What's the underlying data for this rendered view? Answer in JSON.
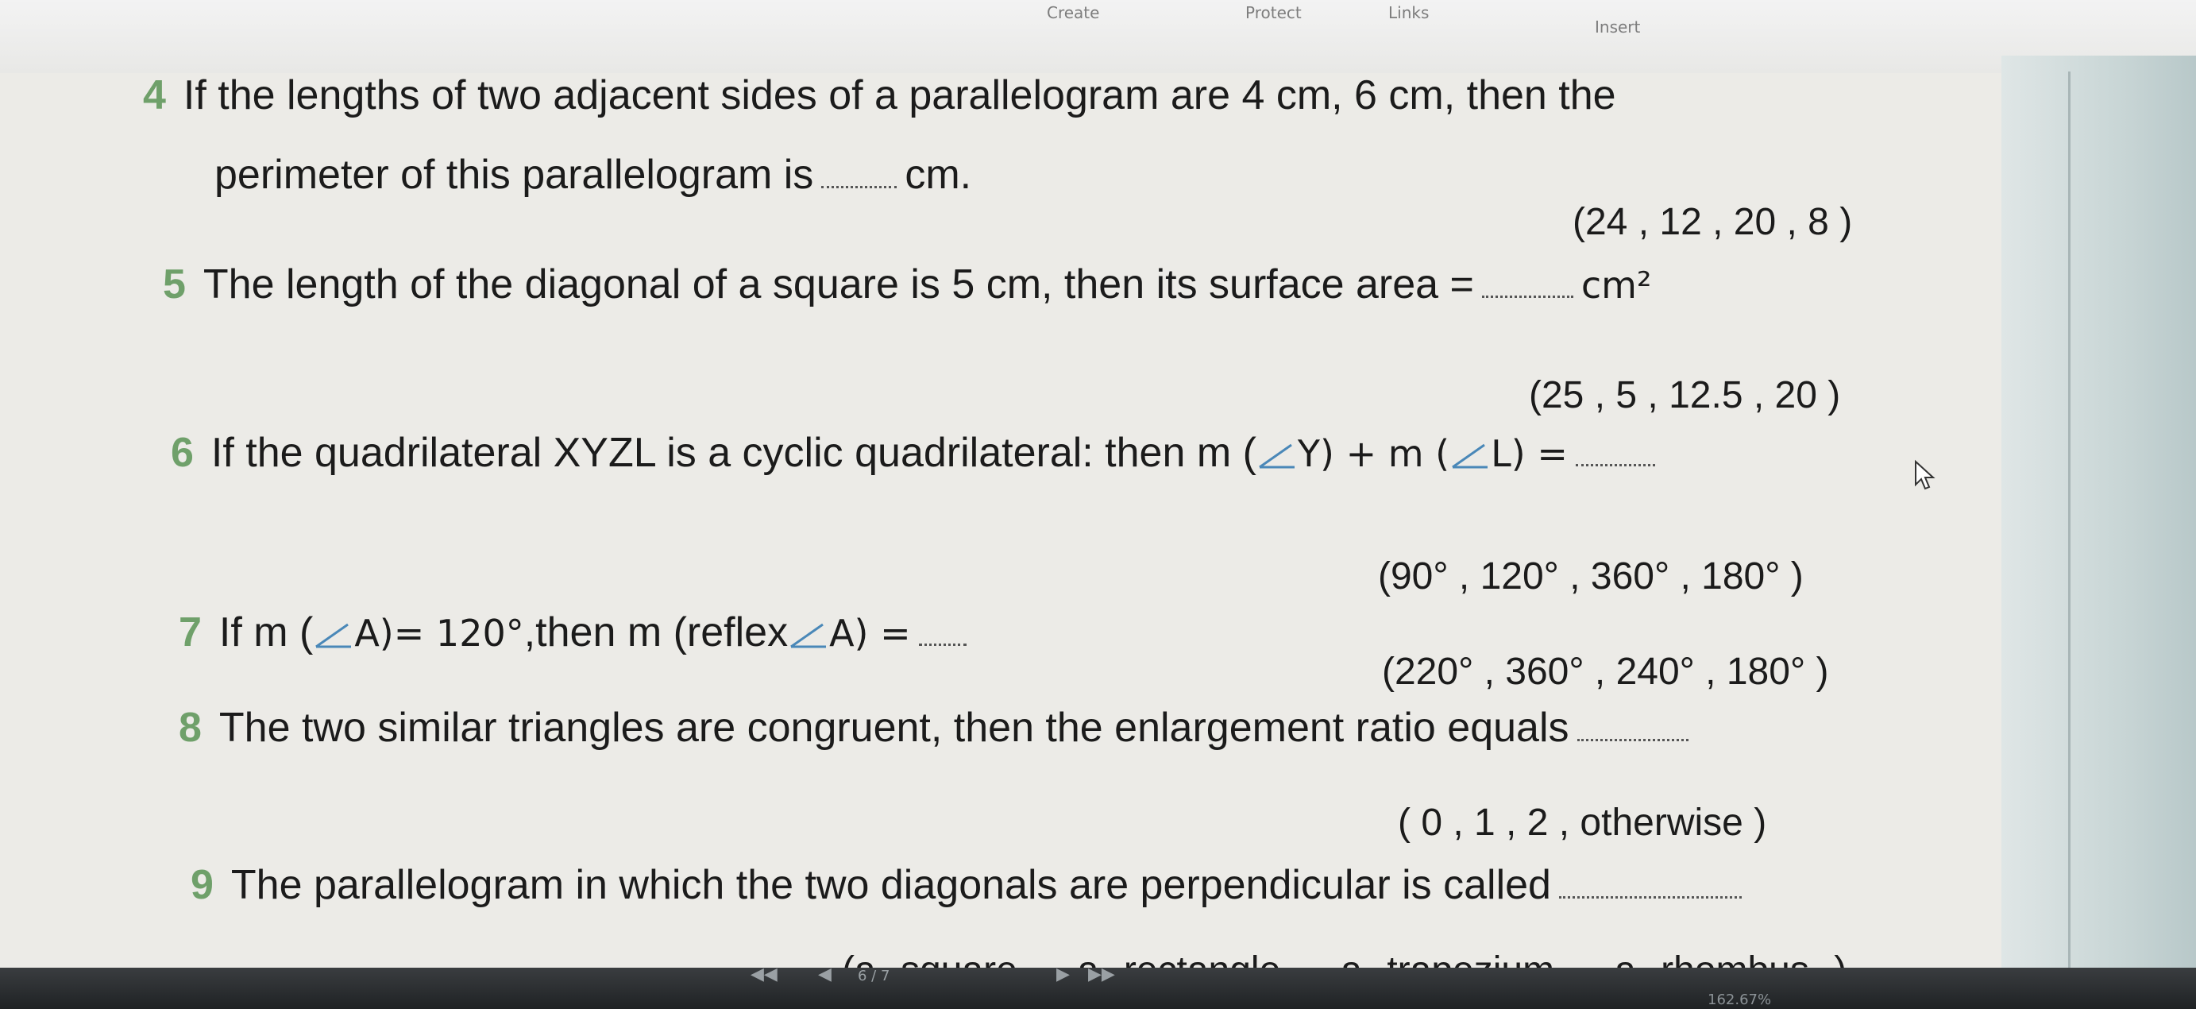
{
  "ribbon": {
    "tabs": [
      "Create",
      "Protect",
      "Links",
      "Insert"
    ]
  },
  "questions": [
    {
      "number": "4",
      "line1": "If the lengths of two adjacent sides of a parallelogram are 4 cm, 6 cm, then the",
      "line2_a": "perimeter of this parallelogram is",
      "line2_b": "cm.",
      "options": "(24 , 12 , 20 , 8 )"
    },
    {
      "number": "5",
      "text": "The length of the diagonal of a square is 5 cm, then its surface area =",
      "unit": "cm²",
      "options": "(25 , 5 , 12.5 , 20 )"
    },
    {
      "number": "6",
      "text_a": "If the quadrilateral XYZL is a cyclic quadrilateral: then m (",
      "text_b": "Y) + m (",
      "text_c": "L) =",
      "options": "(90° , 120° , 360° , 180° )"
    },
    {
      "number": "7",
      "text_a": "If m (",
      "text_b": "A)= 120°",
      "text_c": ",then m (reflex",
      "text_d": "A) =",
      "options": "(220° , 360° , 240° , 180° )"
    },
    {
      "number": "8",
      "text": "The two similar triangles are congruent, then the enlargement ratio equals",
      "options": "( 0 , 1 , 2 , otherwise )"
    },
    {
      "number": "9",
      "text": "The parallelogram in which the two diagonals are perpendicular is called",
      "options": "(a square , a rectangle , a trapezium , a rhombus )"
    }
  ],
  "toolbar": {
    "first_page": "◀◀",
    "prev_page": "◀",
    "page_indicator": "6 / 7",
    "next_page": "▶",
    "last_page": "▶▶",
    "zoom": "162.67%"
  },
  "icons": {
    "cursor": "mouse-pointer-icon",
    "angle": "angle-icon"
  }
}
